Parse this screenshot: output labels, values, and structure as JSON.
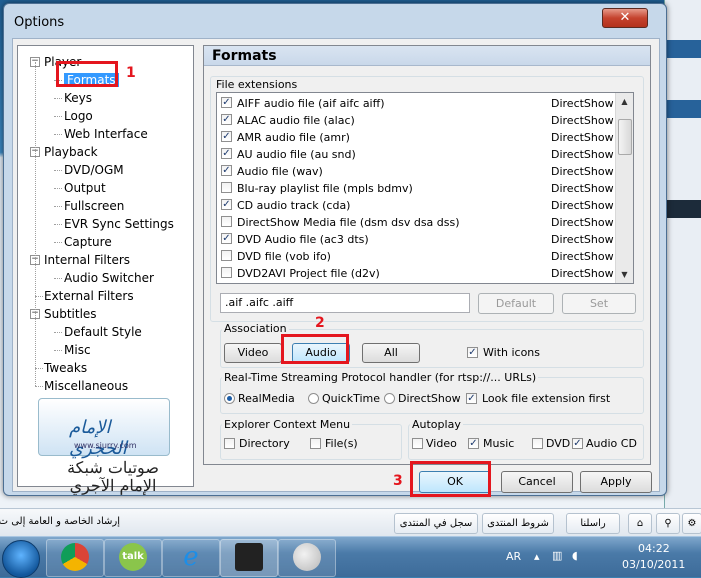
{
  "dialog": {
    "title": "Options",
    "close_glyph": "✕"
  },
  "tree": [
    {
      "label": "Player",
      "level": 0,
      "expander": "−"
    },
    {
      "label": "Formats",
      "level": 1,
      "selected": true
    },
    {
      "label": "Keys",
      "level": 1
    },
    {
      "label": "Logo",
      "level": 1
    },
    {
      "label": "Web Interface",
      "level": 1
    },
    {
      "label": "Playback",
      "level": 0,
      "expander": "−"
    },
    {
      "label": "DVD/OGM",
      "level": 1
    },
    {
      "label": "Output",
      "level": 1
    },
    {
      "label": "Fullscreen",
      "level": 1
    },
    {
      "label": "EVR Sync Settings",
      "level": 1
    },
    {
      "label": "Capture",
      "level": 1
    },
    {
      "label": "Internal Filters",
      "level": 0,
      "expander": "−"
    },
    {
      "label": "Audio Switcher",
      "level": 1
    },
    {
      "label": "External Filters",
      "level": 0
    },
    {
      "label": "Subtitles",
      "level": 0,
      "expander": "−"
    },
    {
      "label": "Default Style",
      "level": 1
    },
    {
      "label": "Misc",
      "level": 1
    },
    {
      "label": "Tweaks",
      "level": 0
    },
    {
      "label": "Miscellaneous",
      "level": 0
    }
  ],
  "logo": {
    "title": "الإمام الحجري",
    "url": "www.sjurry.com",
    "caption_line1": "صوتيات شبكة",
    "caption_line2": "الإمام الآجري"
  },
  "panel": {
    "title": "Formats",
    "file_extensions_label": "File extensions",
    "files": [
      {
        "name": "AIFF audio file (aif aifc aiff)",
        "filter": "DirectShow",
        "checked": true
      },
      {
        "name": "ALAC audio file (alac)",
        "filter": "DirectShow",
        "checked": true
      },
      {
        "name": "AMR audio file (amr)",
        "filter": "DirectShow",
        "checked": true
      },
      {
        "name": "AU audio file (au snd)",
        "filter": "DirectShow",
        "checked": true
      },
      {
        "name": "Audio file (wav)",
        "filter": "DirectShow",
        "checked": true
      },
      {
        "name": "Blu-ray playlist file (mpls bdmv)",
        "filter": "DirectShow",
        "checked": false
      },
      {
        "name": "CD audio track (cda)",
        "filter": "DirectShow",
        "checked": true
      },
      {
        "name": "DirectShow Media file (dsm dsv dsa dss)",
        "filter": "DirectShow",
        "checked": false
      },
      {
        "name": "DVD Audio file (ac3 dts)",
        "filter": "DirectShow",
        "checked": true
      },
      {
        "name": "DVD file (vob ifo)",
        "filter": "DirectShow",
        "checked": false
      },
      {
        "name": "DVD2AVI Project file (d2v)",
        "filter": "DirectShow",
        "checked": false
      }
    ],
    "extensions_value": ".aif .aifc .aiff",
    "default_label": "Default",
    "set_label": "Set",
    "association_label": "Association",
    "video_label": "Video",
    "audio_label": "Audio",
    "all_label": "All",
    "with_icons_label": "With icons",
    "rtsp_label": "Real-Time Streaming Protocol handler (for rtsp://... URLs)",
    "realmedia_label": "RealMedia",
    "quicktime_label": "QuickTime",
    "directshow_label": "DirectShow",
    "look_ext_label": "Look file extension first",
    "explorer_label": "Explorer Context Menu",
    "directory_label": "Directory",
    "files_label": "File(s)",
    "autoplay_label": "Autoplay",
    "ap_video_label": "Video",
    "ap_music_label": "Music",
    "ap_dvd_label": "DVD",
    "ap_audiocd_label": "Audio CD",
    "check_glyph": "✓",
    "scroll_up": "▲",
    "scroll_down": "▼"
  },
  "buttons": {
    "ok_label": "OK",
    "cancel_label": "Cancel",
    "apply_label": "Apply"
  },
  "annotations": {
    "n1": "1",
    "n2": "2",
    "n3": "3",
    "color": "#e4161e"
  },
  "forumbar": {
    "left_text": "إرشاد الخاصة و العامة إلى ت",
    "register": "سجل في المنتدى",
    "rules": "شروط المنتدى",
    "contact": "راسلنا"
  },
  "taskbar": {
    "lang": "AR",
    "time": "04:22",
    "date": "03/10/2011"
  }
}
